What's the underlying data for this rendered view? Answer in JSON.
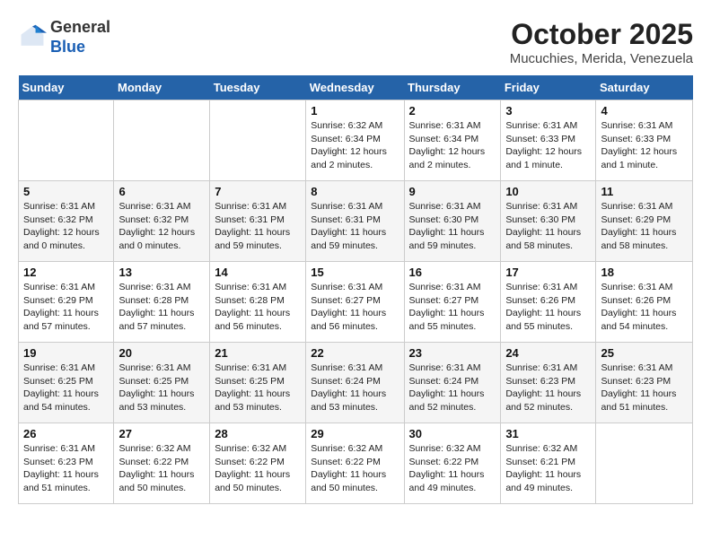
{
  "header": {
    "logo_line1": "General",
    "logo_line2": "Blue",
    "month": "October 2025",
    "location": "Mucuchies, Merida, Venezuela"
  },
  "weekdays": [
    "Sunday",
    "Monday",
    "Tuesday",
    "Wednesday",
    "Thursday",
    "Friday",
    "Saturday"
  ],
  "weeks": [
    [
      {
        "day": "",
        "info": ""
      },
      {
        "day": "",
        "info": ""
      },
      {
        "day": "",
        "info": ""
      },
      {
        "day": "1",
        "info": "Sunrise: 6:32 AM\nSunset: 6:34 PM\nDaylight: 12 hours and 2 minutes."
      },
      {
        "day": "2",
        "info": "Sunrise: 6:31 AM\nSunset: 6:34 PM\nDaylight: 12 hours and 2 minutes."
      },
      {
        "day": "3",
        "info": "Sunrise: 6:31 AM\nSunset: 6:33 PM\nDaylight: 12 hours and 1 minute."
      },
      {
        "day": "4",
        "info": "Sunrise: 6:31 AM\nSunset: 6:33 PM\nDaylight: 12 hours and 1 minute."
      }
    ],
    [
      {
        "day": "5",
        "info": "Sunrise: 6:31 AM\nSunset: 6:32 PM\nDaylight: 12 hours and 0 minutes."
      },
      {
        "day": "6",
        "info": "Sunrise: 6:31 AM\nSunset: 6:32 PM\nDaylight: 12 hours and 0 minutes."
      },
      {
        "day": "7",
        "info": "Sunrise: 6:31 AM\nSunset: 6:31 PM\nDaylight: 11 hours and 59 minutes."
      },
      {
        "day": "8",
        "info": "Sunrise: 6:31 AM\nSunset: 6:31 PM\nDaylight: 11 hours and 59 minutes."
      },
      {
        "day": "9",
        "info": "Sunrise: 6:31 AM\nSunset: 6:30 PM\nDaylight: 11 hours and 59 minutes."
      },
      {
        "day": "10",
        "info": "Sunrise: 6:31 AM\nSunset: 6:30 PM\nDaylight: 11 hours and 58 minutes."
      },
      {
        "day": "11",
        "info": "Sunrise: 6:31 AM\nSunset: 6:29 PM\nDaylight: 11 hours and 58 minutes."
      }
    ],
    [
      {
        "day": "12",
        "info": "Sunrise: 6:31 AM\nSunset: 6:29 PM\nDaylight: 11 hours and 57 minutes."
      },
      {
        "day": "13",
        "info": "Sunrise: 6:31 AM\nSunset: 6:28 PM\nDaylight: 11 hours and 57 minutes."
      },
      {
        "day": "14",
        "info": "Sunrise: 6:31 AM\nSunset: 6:28 PM\nDaylight: 11 hours and 56 minutes."
      },
      {
        "day": "15",
        "info": "Sunrise: 6:31 AM\nSunset: 6:27 PM\nDaylight: 11 hours and 56 minutes."
      },
      {
        "day": "16",
        "info": "Sunrise: 6:31 AM\nSunset: 6:27 PM\nDaylight: 11 hours and 55 minutes."
      },
      {
        "day": "17",
        "info": "Sunrise: 6:31 AM\nSunset: 6:26 PM\nDaylight: 11 hours and 55 minutes."
      },
      {
        "day": "18",
        "info": "Sunrise: 6:31 AM\nSunset: 6:26 PM\nDaylight: 11 hours and 54 minutes."
      }
    ],
    [
      {
        "day": "19",
        "info": "Sunrise: 6:31 AM\nSunset: 6:25 PM\nDaylight: 11 hours and 54 minutes."
      },
      {
        "day": "20",
        "info": "Sunrise: 6:31 AM\nSunset: 6:25 PM\nDaylight: 11 hours and 53 minutes."
      },
      {
        "day": "21",
        "info": "Sunrise: 6:31 AM\nSunset: 6:25 PM\nDaylight: 11 hours and 53 minutes."
      },
      {
        "day": "22",
        "info": "Sunrise: 6:31 AM\nSunset: 6:24 PM\nDaylight: 11 hours and 53 minutes."
      },
      {
        "day": "23",
        "info": "Sunrise: 6:31 AM\nSunset: 6:24 PM\nDaylight: 11 hours and 52 minutes."
      },
      {
        "day": "24",
        "info": "Sunrise: 6:31 AM\nSunset: 6:23 PM\nDaylight: 11 hours and 52 minutes."
      },
      {
        "day": "25",
        "info": "Sunrise: 6:31 AM\nSunset: 6:23 PM\nDaylight: 11 hours and 51 minutes."
      }
    ],
    [
      {
        "day": "26",
        "info": "Sunrise: 6:31 AM\nSunset: 6:23 PM\nDaylight: 11 hours and 51 minutes."
      },
      {
        "day": "27",
        "info": "Sunrise: 6:32 AM\nSunset: 6:22 PM\nDaylight: 11 hours and 50 minutes."
      },
      {
        "day": "28",
        "info": "Sunrise: 6:32 AM\nSunset: 6:22 PM\nDaylight: 11 hours and 50 minutes."
      },
      {
        "day": "29",
        "info": "Sunrise: 6:32 AM\nSunset: 6:22 PM\nDaylight: 11 hours and 50 minutes."
      },
      {
        "day": "30",
        "info": "Sunrise: 6:32 AM\nSunset: 6:22 PM\nDaylight: 11 hours and 49 minutes."
      },
      {
        "day": "31",
        "info": "Sunrise: 6:32 AM\nSunset: 6:21 PM\nDaylight: 11 hours and 49 minutes."
      },
      {
        "day": "",
        "info": ""
      }
    ]
  ]
}
